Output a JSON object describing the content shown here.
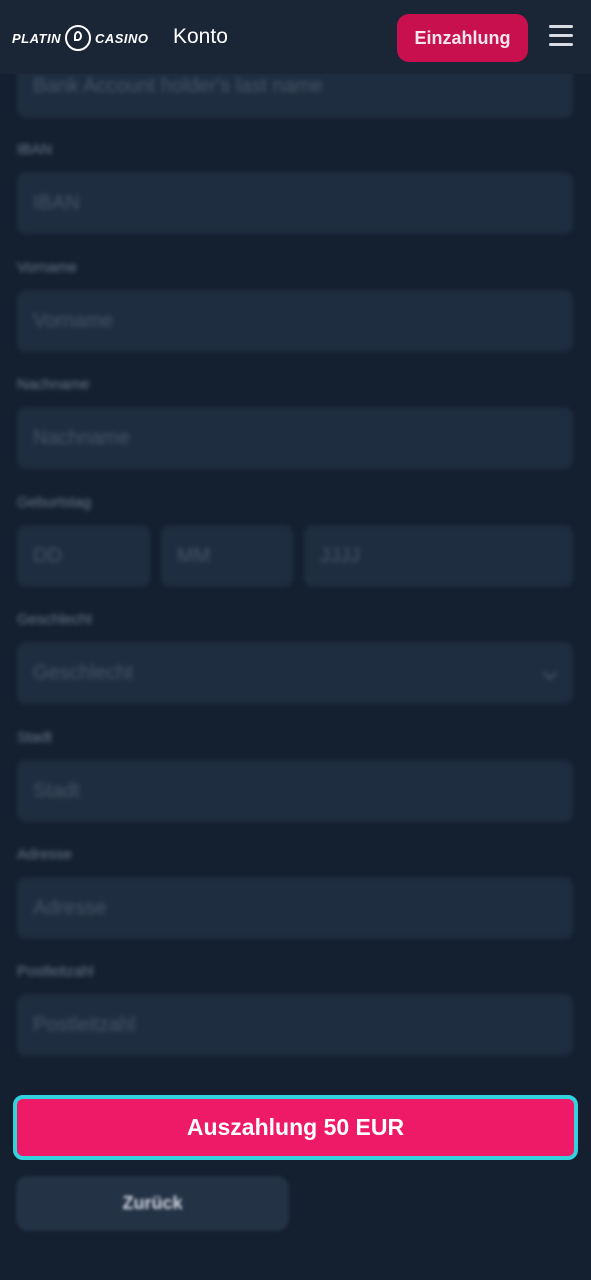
{
  "header": {
    "logo_left": "PLATIN",
    "logo_right": "CASINO",
    "title": "Konto",
    "deposit_label": "Einzahlung",
    "menu_icon": "hamburger-menu-icon"
  },
  "form": {
    "last_name_placeholder": "Bank Account holder's last name",
    "iban_label": "IBAN",
    "iban_placeholder": "IBAN",
    "vorname_label": "Vorname",
    "vorname_placeholder": "Vorname",
    "nachname_label": "Nachname",
    "nachname_placeholder": "Nachname",
    "geburtstag_label": "Geburtstag",
    "day_placeholder": "DD",
    "month_placeholder": "MM",
    "year_placeholder": "JJJJ",
    "geschlecht_label": "Geschlecht",
    "geschlecht_placeholder": "Geschlecht",
    "stadt_label": "Stadt",
    "stadt_placeholder": "Stadt",
    "adresse_label": "Adresse",
    "adresse_placeholder": "Adresse",
    "plz_label": "Postleitzahl",
    "plz_placeholder": "Postleitzahl"
  },
  "actions": {
    "submit_label": "Auszahlung 50 EUR",
    "back_label": "Zurück"
  },
  "colors": {
    "background": "#14202f",
    "field": "#1f2d40",
    "accent_pink": "#ee1a68",
    "focus_outline": "#34d2dd"
  }
}
